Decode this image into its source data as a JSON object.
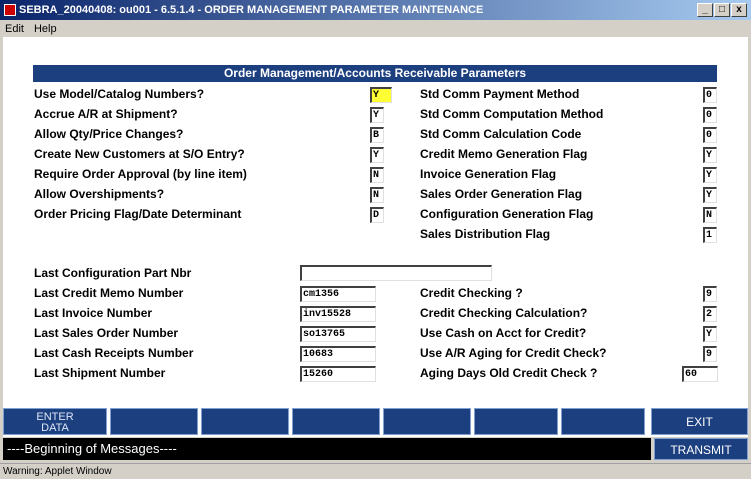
{
  "window": {
    "title": "SEBRA_20040408: ou001 - 6.5.1.4 - ORDER MANAGEMENT PARAMETER MAINTENANCE",
    "min": "_",
    "max": "□",
    "close": "x"
  },
  "menu": [
    "Edit",
    "Help"
  ],
  "header": "Order Management/Accounts Receivable Parameters",
  "left_params": [
    {
      "label": "Use Model/Catalog Numbers?",
      "value": "Y"
    },
    {
      "label": "Accrue A/R at Shipment?",
      "value": "Y"
    },
    {
      "label": "Allow Qty/Price Changes?",
      "value": "B"
    },
    {
      "label": "Create New Customers at S/O Entry?",
      "value": "Y"
    },
    {
      "label": "Require Order Approval (by line item)",
      "value": "N"
    },
    {
      "label": "Allow Overshipments?",
      "value": "N"
    },
    {
      "label": "Order Pricing Flag/Date Determinant",
      "value": "D"
    }
  ],
  "right_params": [
    {
      "label": "Std Comm Payment Method",
      "value": "0"
    },
    {
      "label": "Std Comm Computation Method",
      "value": "0"
    },
    {
      "label": "Std Comm Calculation Code",
      "value": "0"
    },
    {
      "label": "Credit Memo Generation Flag",
      "value": "Y"
    },
    {
      "label": "Invoice Generation Flag",
      "value": "Y"
    },
    {
      "label": "Sales Order Generation Flag",
      "value": "Y"
    },
    {
      "label": "Configuration Generation Flag",
      "value": "N"
    },
    {
      "label": "Sales Distribution Flag",
      "value": "1"
    }
  ],
  "last_numbers": [
    {
      "label": "Last Configuration Part Nbr",
      "value": ""
    },
    {
      "label": "Last Credit Memo Number",
      "value": "cm1356"
    },
    {
      "label": "Last Invoice Number",
      "value": "inv15528"
    },
    {
      "label": "Last Sales Order Number",
      "value": "so13765"
    },
    {
      "label": "Last Cash Receipts Number",
      "value": "10683"
    },
    {
      "label": "Last Shipment Number",
      "value": "15260"
    }
  ],
  "credit_params": [
    {
      "label": "Credit Checking ?",
      "value": "9"
    },
    {
      "label": "Credit Checking Calculation?",
      "value": "2"
    },
    {
      "label": "Use Cash on Acct for Credit?",
      "value": "Y"
    },
    {
      "label": "Use A/R Aging for Credit Check?",
      "value": "9"
    },
    {
      "label": "Aging Days Old Credit Check ?",
      "value": "60"
    }
  ],
  "buttons": {
    "enter_line1": "ENTER",
    "enter_line2": "DATA",
    "exit": "EXIT",
    "transmit": "TRANSMIT"
  },
  "message": "----Beginning of Messages----",
  "status": "Warning: Applet Window",
  "colors": {
    "header_bg": "#1c3f7f",
    "focus_field": "#ffff33"
  }
}
